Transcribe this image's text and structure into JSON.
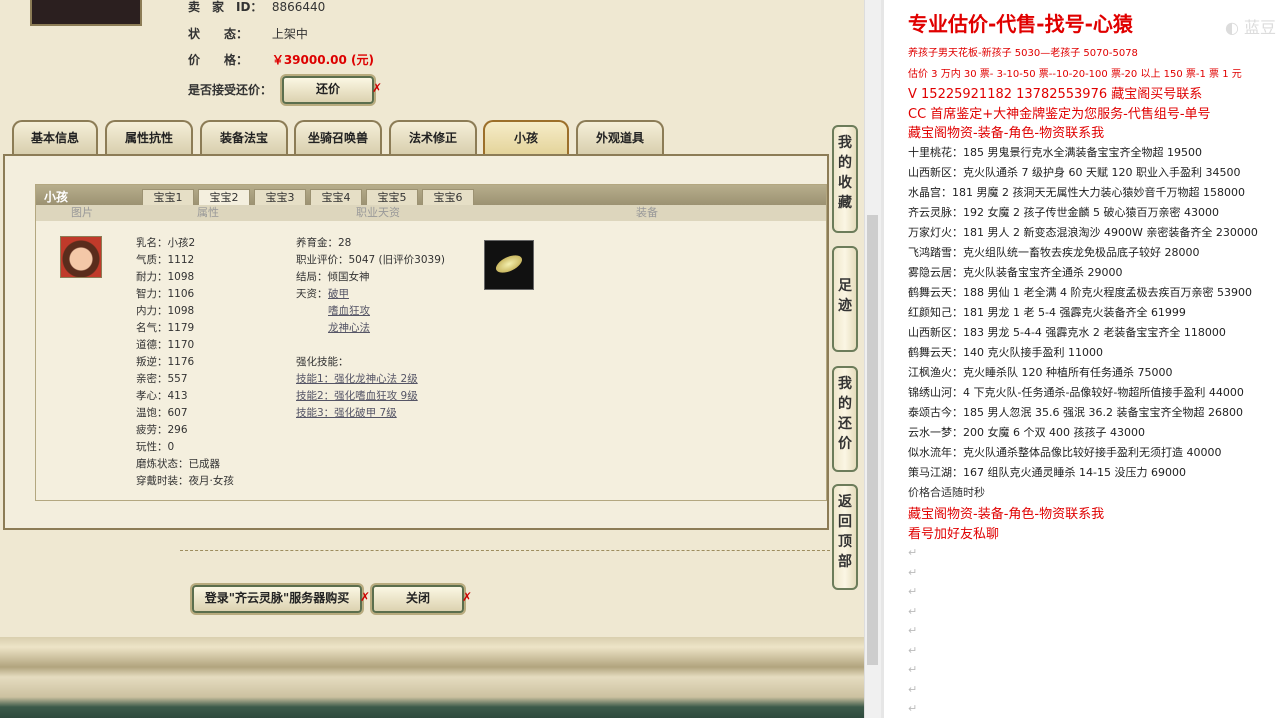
{
  "seller": {
    "label": "卖　家　ID：",
    "value": "8866440"
  },
  "status": {
    "label": "状　　态：",
    "value": "上架中"
  },
  "price": {
    "label": "价　　格：",
    "value": "￥39000.00 (元)"
  },
  "counter": {
    "label": "是否接受还价：",
    "button": "还价"
  },
  "tabs": [
    "基本信息",
    "属性抗性",
    "装备法宝",
    "坐骑召唤兽",
    "法术修正",
    "小孩",
    "外观道具"
  ],
  "active_tab": "小孩",
  "child_panel": {
    "title": "小孩",
    "baby_tabs": [
      "宝宝1",
      "宝宝2",
      "宝宝3",
      "宝宝4",
      "宝宝5",
      "宝宝6"
    ],
    "columns": [
      "图片",
      "属性",
      "职业天资",
      "装备"
    ],
    "attrs": [
      "乳名：小孩2",
      "气质：1112",
      "耐力：1098",
      "智力：1106",
      "内力：1098",
      "名气：1179",
      "道德：1170",
      "叛逆：1176",
      "亲密：557",
      "孝心：413",
      "温饱：607",
      "疲劳：296",
      "玩性：0",
      "磨炼状态：已成器",
      "穿戴时装：夜月·女孩"
    ],
    "career": {
      "money": "养育金：28",
      "rating": "职业评价：5047 (旧评价3039)",
      "ending": "结局：倾国女神",
      "talent_label": "天资：",
      "talents": [
        "破甲",
        "嗜血狂攻",
        "龙神心法"
      ],
      "skill_label": "强化技能：",
      "skills": [
        "技能1：强化龙神心法 2级",
        "技能2：强化嗜血狂攻 9级",
        "技能3：强化破甲 7级"
      ]
    }
  },
  "side_buttons": [
    "我的收藏",
    "足迹",
    "我的还价",
    "返回顶部"
  ],
  "bottom_buttons": {
    "login": "登录\"齐云灵脉\"服务器购买",
    "close": "关闭"
  },
  "notes": {
    "title": "专业估价-代售-找号-心猿",
    "red_lines": [
      "养孩子男天花板-新孩子 5030—老孩子 5070-5078",
      "估价 3 万内 30 票- 3-10-50 票--10-20-100 票-20 以上 150 票-1 票 1 元",
      "V 15225921182      13782553976    藏宝阁买号联系",
      "CC 首席鉴定+大神金牌鉴定为您服务-代售组号-单号",
      "藏宝阁物资-装备-角色-物资联系我"
    ],
    "listings": [
      "十里桃花：185 男鬼景行克水全满装备宝宝齐全物超 19500",
      "山西新区：克火队通杀 7 级护身 60 天赋 120 职业入手盈利 34500",
      "水晶宫：181 男魔 2 孩洞天无属性大力装心猿妙音千万物超 158000",
      "齐云灵脉：192 女魔 2 孩子传世金麟 5 破心猿百万亲密 43000",
      "万家灯火：181 男人 2 新变态混浪淘沙 4900W 亲密装备齐全 230000",
      "飞鸿踏雪：克火组队统一畜牧去疾龙免极品底子较好 28000",
      "雾隐云居：克火队装备宝宝齐全通杀 29000",
      "鹤舞云天：188 男仙 1 老全满 4 阶克火程度孟极去疾百万亲密 53900",
      "红颜知己：181 男龙 1 老 5-4 强霹克火装备齐全 61999",
      "山西新区：183 男龙 5-4-4 强霹克水 2 老装备宝宝齐全 118000",
      "鹤舞云天：140 克火队接手盈利 11000",
      "江枫渔火：克火睡杀队 120 种植所有任务通杀 75000",
      "锦绣山河：4 下克火队-任务通杀-品像较好-物超所值接手盈利 44000",
      "泰颂古今：185 男人忽泯 35.6 强泯 36.2 装备宝宝齐全物超 26800",
      "云水一梦：200 女魔 6 个双 400 孩孩子 43000",
      "似水流年：克火队通杀整体品像比较好接手盈利无须打造 40000",
      "策马江湖：167 组队克火通灵睡杀 14-15 没压力 69000",
      "价格合适随时秒"
    ],
    "footer": [
      "藏宝阁物资-装备-角色-物资联系我",
      "看号加好友私聊"
    ],
    "para_mark": "↵"
  }
}
